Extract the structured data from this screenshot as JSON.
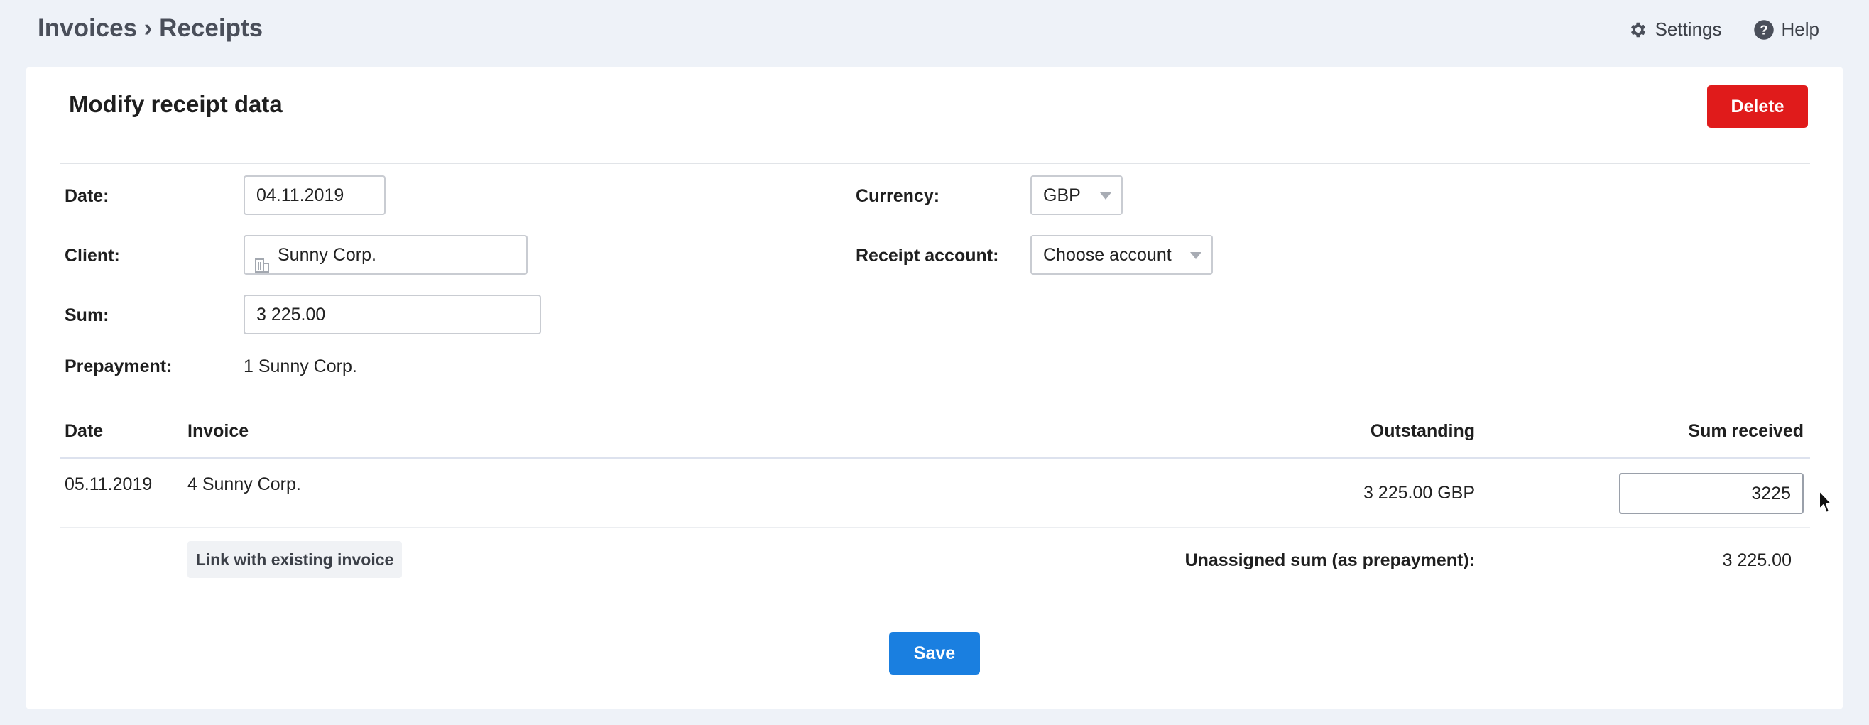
{
  "header": {
    "breadcrumb": "Invoices › Receipts",
    "settings_label": "Settings",
    "help_label": "Help"
  },
  "form": {
    "title": "Modify receipt data",
    "delete_label": "Delete",
    "date_label": "Date:",
    "date_value": "04.11.2019",
    "currency_label": "Currency:",
    "currency_value": "GBP",
    "client_label": "Client:",
    "client_value": "Sunny Corp.",
    "account_label": "Receipt account:",
    "account_value": "Choose account",
    "sum_label": "Sum:",
    "sum_value": "3 225.00",
    "prepayment_label": "Prepayment:",
    "prepayment_value": "1 Sunny Corp."
  },
  "table": {
    "headers": {
      "date": "Date",
      "invoice": "Invoice",
      "outstanding": "Outstanding",
      "sum_received": "Sum received"
    },
    "rows": [
      {
        "date": "05.11.2019",
        "invoice": "4 Sunny Corp.",
        "outstanding": "3 225.00 GBP",
        "sum_received": "3225"
      }
    ]
  },
  "footer": {
    "link_invoice_label": "Link with existing invoice",
    "unassigned_label": "Unassigned sum (as prepayment):",
    "unassigned_value": "3 225.00",
    "save_label": "Save"
  },
  "colors": {
    "delete": "#e01b1b",
    "save": "#1a7fe0",
    "background": "#eef2f8"
  }
}
